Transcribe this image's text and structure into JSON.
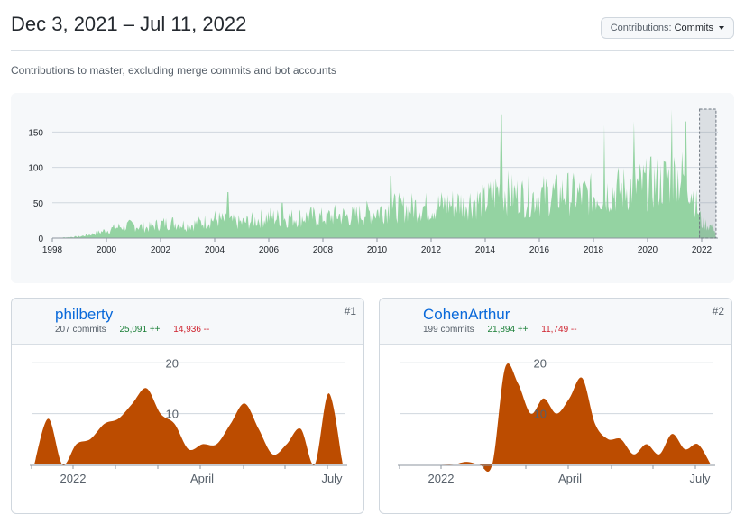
{
  "header": {
    "title": "Dec 3, 2021 – Jul 11, 2022",
    "contrib_label": "Contributions:",
    "contrib_value": "Commits",
    "subtitle": "Contributions to master, excluding merge commits and bot accounts"
  },
  "colors": {
    "accent_green": "#94d3a2",
    "accent_orange": "#bc4c00",
    "link": "#0969da"
  },
  "chart_data": [
    {
      "type": "area",
      "x_ticks": [
        "1998",
        "2000",
        "2002",
        "2004",
        "2006",
        "2008",
        "2010",
        "2012",
        "2014",
        "2016",
        "2018",
        "2020",
        "2022"
      ],
      "y_ticks": [
        "0",
        "50",
        "100",
        "150"
      ],
      "ylim": [
        0,
        190
      ],
      "xlim": [
        1998,
        2022.6
      ],
      "selection": [
        "2021-12-03",
        "2022-07-11"
      ],
      "envelope": [
        [
          1998,
          0
        ],
        [
          1999,
          3
        ],
        [
          1999.5,
          8
        ],
        [
          2000,
          15
        ],
        [
          2000.5,
          22
        ],
        [
          2001,
          25
        ],
        [
          2001.5,
          20
        ],
        [
          2002,
          28
        ],
        [
          2002.5,
          30
        ],
        [
          2003,
          25
        ],
        [
          2003.5,
          30
        ],
        [
          2004,
          38
        ],
        [
          2004.5,
          32
        ],
        [
          2005,
          30
        ],
        [
          2005.5,
          35
        ],
        [
          2006,
          42
        ],
        [
          2006.5,
          38
        ],
        [
          2007,
          40
        ],
        [
          2007.5,
          42
        ],
        [
          2008,
          40
        ],
        [
          2008.5,
          45
        ],
        [
          2009,
          42
        ],
        [
          2009.5,
          48
        ],
        [
          2010,
          52
        ],
        [
          2010.5,
          60
        ],
        [
          2011,
          58
        ],
        [
          2011.5,
          62
        ],
        [
          2012,
          60
        ],
        [
          2012.5,
          65
        ],
        [
          2013,
          68
        ],
        [
          2013.5,
          72
        ],
        [
          2014,
          70
        ],
        [
          2014.5,
          95
        ],
        [
          2015,
          85
        ],
        [
          2015.5,
          80
        ],
        [
          2016,
          82
        ],
        [
          2016.5,
          85
        ],
        [
          2017,
          88
        ],
        [
          2017.5,
          82
        ],
        [
          2018,
          85
        ],
        [
          2018.5,
          90
        ],
        [
          2019,
          95
        ],
        [
          2019.5,
          100
        ],
        [
          2020,
          105
        ],
        [
          2020.5,
          110
        ],
        [
          2021,
          120
        ],
        [
          2021.5,
          118
        ],
        [
          2022,
          30
        ],
        [
          2022.5,
          20
        ]
      ],
      "spikes": [
        [
          2004.5,
          65
        ],
        [
          2006.5,
          50
        ],
        [
          2010.5,
          88
        ],
        [
          2014.6,
          175
        ],
        [
          2018.4,
          160
        ],
        [
          2019.5,
          165
        ],
        [
          2020.9,
          182
        ],
        [
          2021.4,
          165
        ]
      ]
    },
    {
      "type": "area",
      "name": "philberty",
      "x_ticks": [
        "2022",
        "April",
        "July"
      ],
      "y_ticks": [
        "10",
        "20"
      ],
      "ylim": [
        0,
        20
      ],
      "values": [
        0,
        9,
        0,
        4,
        5,
        8,
        9,
        12,
        15,
        10,
        8,
        3,
        4,
        4,
        8,
        12,
        7,
        2,
        4,
        7,
        0,
        14,
        0
      ]
    },
    {
      "type": "area",
      "name": "CohenArthur",
      "x_ticks": [
        "2022",
        "April",
        "July"
      ],
      "y_ticks": [
        "10",
        "20"
      ],
      "ylim": [
        0,
        20
      ],
      "values": [
        0,
        0,
        0,
        0,
        0,
        0.5,
        0,
        0,
        19,
        16,
        10,
        13,
        10,
        13,
        17,
        8,
        5,
        5,
        2,
        4,
        2,
        6,
        3,
        4,
        0
      ]
    }
  ],
  "contributors": [
    {
      "name": "philberty",
      "commits": "207 commits",
      "additions": "25,091 ++",
      "deletions": "14,936 --",
      "rank": "#1"
    },
    {
      "name": "CohenArthur",
      "commits": "199 commits",
      "additions": "21,894 ++",
      "deletions": "11,749 --",
      "rank": "#2"
    }
  ]
}
